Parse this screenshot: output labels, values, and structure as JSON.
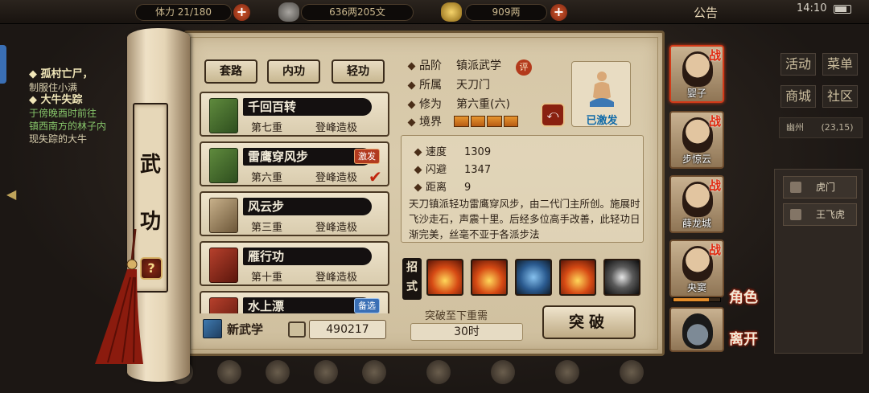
{
  "topbar": {
    "capacity": "体力 21/180",
    "silver": "636两205文",
    "gold": "909两",
    "notice": "公告",
    "time": "14:10"
  },
  "quest": {
    "items": [
      {
        "title": "孤村亡尸，",
        "lines": [
          "制服住小满"
        ],
        "green": []
      },
      {
        "title": "大牛失踪",
        "lines": [
          "现失踪的大牛"
        ],
        "green": [
          "于傍晚酉时前往",
          "镇西南方的林子内"
        ]
      }
    ]
  },
  "right_menu": {
    "buttons": [
      "活动",
      "菜单",
      "商城",
      "社区"
    ],
    "location": "幽州",
    "coords": "(23,15)",
    "npcs": [
      "虎门",
      "王飞虎"
    ]
  },
  "scroll": {
    "title_1": "武",
    "title_2": "功",
    "help": "?"
  },
  "tabs": [
    "套路",
    "内功",
    "轻功"
  ],
  "skills": [
    {
      "name": "千回百转",
      "level": "第七重",
      "mastery": "登峰造极",
      "badge": "",
      "book": "green"
    },
    {
      "name": "雷鹰穿风步",
      "level": "第六重",
      "mastery": "登峰造极",
      "badge": "激发",
      "book": "green",
      "checked": true
    },
    {
      "name": "风云步",
      "level": "第三重",
      "mastery": "登峰造极",
      "badge": "",
      "book": "tan"
    },
    {
      "name": "雁行功",
      "level": "第十重",
      "mastery": "登峰造极",
      "badge": "",
      "book": "red"
    },
    {
      "name": "水上漂",
      "level": "",
      "mastery": "",
      "badge": "备选",
      "book": "red"
    }
  ],
  "footer_left": {
    "new_skill": "新武学",
    "points": "490217"
  },
  "detail": {
    "grade_label": "品阶",
    "grade_value": "镇派武学",
    "grade_badge": "评",
    "school_label": "所属",
    "school_value": "天刀门",
    "cultivation_label": "修为",
    "cultivation_value": "第六重(六)",
    "realm_label": "境界",
    "realm_segments": 4,
    "activated": "已激发",
    "swap_icon": "swap-icon"
  },
  "stats": [
    {
      "label": "速度",
      "value": "1309"
    },
    {
      "label": "闪避",
      "value": "1347"
    },
    {
      "label": "距离",
      "value": "9"
    }
  ],
  "description": "天刀镇派轻功雷鹰穿风步，由二代门主所创。施展时飞沙走石，声震十里。后经多位高手改善，此轻功日渐完美，丝毫不亚于各派步法",
  "moves": {
    "label": "招式",
    "icons": [
      "fire",
      "fire",
      "blue",
      "fire",
      "dark"
    ]
  },
  "breakthrough": {
    "label": "突破至下重需",
    "time": "30时",
    "button": "突破"
  },
  "party": [
    {
      "name": "婴子",
      "battle": "战",
      "selected": true
    },
    {
      "name": "步惊云",
      "battle": "战",
      "selected": false
    },
    {
      "name": "薛龙城",
      "battle": "战",
      "selected": false
    },
    {
      "name": "央窦",
      "battle": "战",
      "selected": false,
      "hp": 0.75
    },
    {
      "name": "",
      "battle": "",
      "selected": false
    }
  ],
  "side_actions": {
    "role": "角色",
    "leave": "离开"
  }
}
